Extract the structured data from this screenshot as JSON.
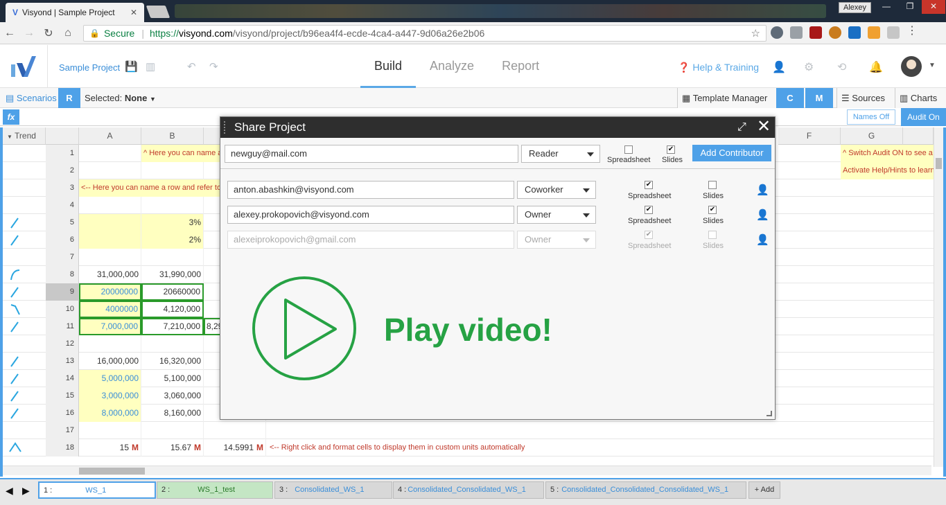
{
  "browser": {
    "tab_title": "Visyond | Sample Project",
    "window_user": "Alexey",
    "secure_label": "Secure",
    "url_scheme": "https://",
    "url_domain": "visyond.com",
    "url_path": "/visyond/project/b96ea4f4-ecde-4ca4-a447-9d06a26e2b06"
  },
  "app": {
    "project_name": "Sample Project",
    "nav": [
      "Build",
      "Analyze",
      "Report"
    ],
    "active_nav": "Build",
    "help_label": "Help & Training"
  },
  "toolbar": {
    "scenarios": "Scenarios",
    "r_button": "R",
    "selected_label": "Selected:",
    "selected_value": "None",
    "template_manager": "Template Manager",
    "c_button": "C",
    "m_button": "M",
    "sources": "Sources",
    "charts": "Charts"
  },
  "formula_bar": {
    "fx": "fx",
    "names_off": "Names Off",
    "audit_on": "Audit On"
  },
  "grid": {
    "trend_header": "Trend",
    "columns": [
      "A",
      "B",
      "C",
      "",
      "E",
      "F",
      "G"
    ],
    "rows": [
      {
        "n": "1",
        "notes": {
          "B": "^ Here you can name a"
        },
        "noteG": "^ Switch Audit ON to see a"
      },
      {
        "n": "2",
        "noteG": "Activate Help/Hints to learn"
      },
      {
        "n": "3",
        "notes": {
          "A": "<-- Here you can name a row and refer to"
        }
      },
      {
        "n": "4"
      },
      {
        "n": "5",
        "B": "3%"
      },
      {
        "n": "6",
        "B": "2%"
      },
      {
        "n": "7"
      },
      {
        "n": "8",
        "A": "31,000,000",
        "B": "31,990,000"
      },
      {
        "n": "9",
        "A": "20000000",
        "B": "20660000"
      },
      {
        "n": "10",
        "A": "4000000",
        "B": "4,120,000"
      },
      {
        "n": "11",
        "A": "7,000,000",
        "B": "7,210,000",
        "C": "8,29"
      },
      {
        "n": "12"
      },
      {
        "n": "13",
        "A": "16,000,000",
        "B": "16,320,000"
      },
      {
        "n": "14",
        "A": "5,000,000",
        "B": "5,100,000"
      },
      {
        "n": "15",
        "A": "3,000,000",
        "B": "3,060,000"
      },
      {
        "n": "16",
        "A": "8,000,000",
        "B": "8,160,000"
      },
      {
        "n": "17"
      },
      {
        "n": "18",
        "A": "15",
        "B": "15.67",
        "C": "14.5991",
        "unit": "M",
        "note": "<-- Right click and format cells to display them in custom units automatically"
      }
    ]
  },
  "sheets": [
    {
      "num": "1 :",
      "name": "WS_1"
    },
    {
      "num": "2 :",
      "name": "WS_1_test"
    },
    {
      "num": "3 :",
      "name": "Consolidated_WS_1"
    },
    {
      "num": "4 :",
      "name": "Consolidated_Consolidated_WS_1"
    },
    {
      "num": "5 :",
      "name": "Consolidated_Consolidated_Consolidated_WS_1"
    }
  ],
  "add_sheet": "+ Add",
  "share_modal": {
    "title": "Share Project",
    "new_email": "newguy@mail.com",
    "new_role": "Reader",
    "spreadsheet_label": "Spreadsheet",
    "slides_label": "Slides",
    "add_button": "Add Contributor",
    "contributors": [
      {
        "email": "anton.abashkin@visyond.com",
        "role": "Coworker",
        "spreadsheet": true,
        "slides": false
      },
      {
        "email": "alexey.prokopovich@visyond.com",
        "role": "Owner",
        "spreadsheet": true,
        "slides": true
      },
      {
        "email": "alexeiprokopovich@gmail.com",
        "role": "Owner",
        "spreadsheet": true,
        "slides": false
      }
    ],
    "video_label": "Play video!"
  }
}
